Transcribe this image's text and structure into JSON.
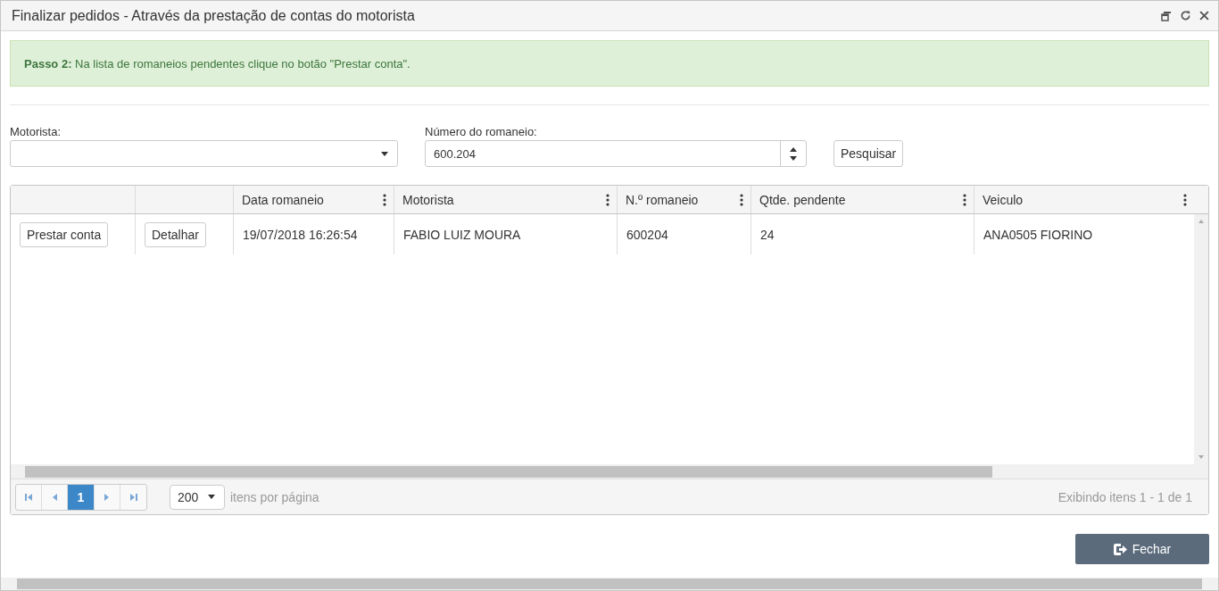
{
  "window": {
    "title": "Finalizar pedidos - Através da prestação de contas do motorista"
  },
  "alert": {
    "text": "**Passo 2:** Na lista de romaneios pendentes clique no botão \"Prestar conta\"."
  },
  "filters": {
    "driver": {
      "label": "Motorista:"
    },
    "number": {
      "label": "Número do romaneio:",
      "value": "600.204"
    },
    "search_button": "Pesquisar"
  },
  "table": {
    "columns": [
      {
        "kind": "action"
      },
      {
        "kind": "action"
      },
      {
        "kind": "data",
        "label": "Data romaneio"
      },
      {
        "kind": "data",
        "label": "Motorista"
      },
      {
        "kind": "data",
        "label": "N.º romaneio"
      },
      {
        "kind": "data",
        "label": "Qtde. pendente"
      },
      {
        "kind": "data",
        "label": "Veiculo"
      }
    ],
    "rows": [
      {
        "cells": [
          "Prestar conta",
          "Detalhar",
          "19/07/2018 16:26:54",
          "FABIO LUIZ MOURA",
          "600204",
          "24",
          "ANA0505 FIORINO"
        ]
      }
    ]
  },
  "pager": {
    "pages": [
      {
        "label": "1",
        "selected": true
      }
    ],
    "page_size": "200",
    "page_size_label": "itens por página",
    "summary": "Exibindo itens 1 - 1 de 1"
  },
  "footer": {
    "close_button": "Fechar"
  }
}
